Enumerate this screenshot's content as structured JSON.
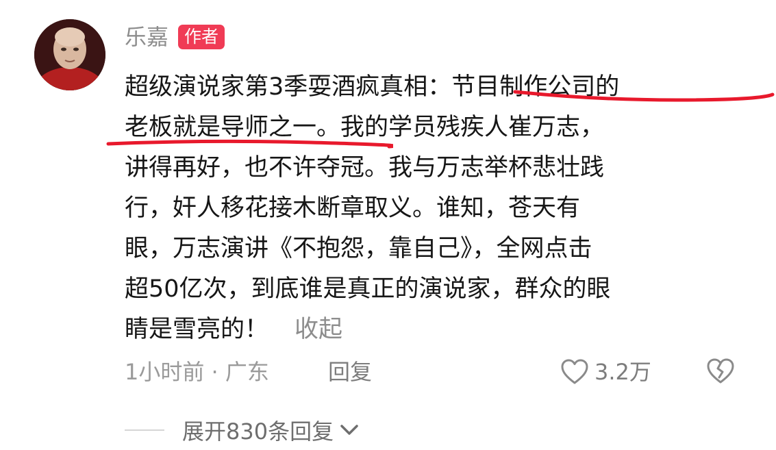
{
  "comment": {
    "author": {
      "name": "乐嘉",
      "badge": "作者"
    },
    "lines": [
      "超级演说家第3季耍酒疯真相：节目制作公司的",
      "老板就是导师之一。我的学员残疾人崔万志，",
      "讲得再好，也不许夺冠。我与万志举杯悲壮践",
      "行，奸人移花接木断章取义。谁知，苍天有",
      "眼，万志演讲《不抱怨，靠自己》，全网点击",
      "超50亿次，到底谁是真正的演说家，群众的眼",
      "睛是雪亮的！"
    ],
    "collapse_label": "收起",
    "meta": {
      "time_location": "1小时前 · 广东",
      "reply_label": "回复"
    },
    "like_count": "3.2万",
    "expand_replies_label": "展开830条回复"
  },
  "colors": {
    "badge": "#f03b55",
    "underline": "#e8192c",
    "muted_text": "#8d8d8d",
    "body_text": "#161616"
  },
  "icons": {
    "like": "heart-outline-icon",
    "dislike": "broken-heart-icon",
    "expand": "chevron-down-icon"
  }
}
